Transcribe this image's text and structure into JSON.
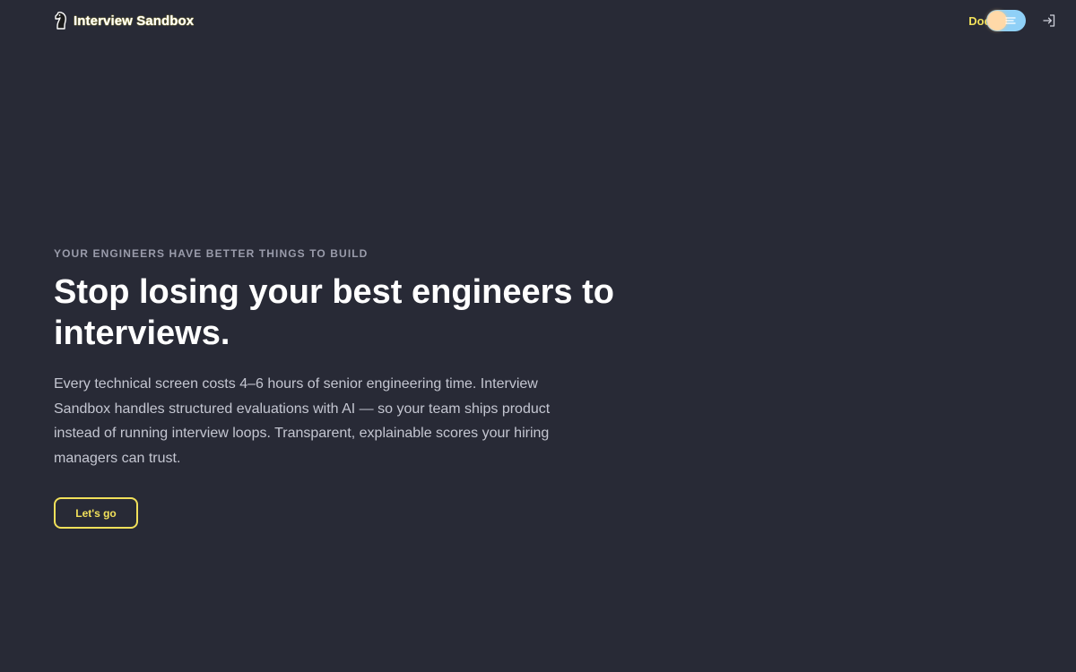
{
  "header": {
    "brand_name": "Interview Sandbox",
    "logo_icon": "chess-knight-icon",
    "docs_label": "Docs",
    "theme_toggle_icon": "sun-icon",
    "signin_icon": "sign-in-icon"
  },
  "hero": {
    "eyebrow": "YOUR ENGINEERS HAVE BETTER THINGS TO BUILD",
    "headline": "Stop losing your best engineers to interviews.",
    "subtext": "Every technical screen costs 4–6 hours of senior engineering time. Interview Sandbox handles structured evaluations with AI — so your team ships product instead of running interview loops. Transparent, explainable scores your hiring managers can trust.",
    "cta_label": "Let's go"
  },
  "colors": {
    "background": "#282a36",
    "accent": "#f1e05a",
    "heading": "#ffffff",
    "body_text": "#c4c6d1",
    "muted_text": "#9a9cab",
    "toggle_track": "#8fd0f7",
    "toggle_knob": "#ffd9a8"
  }
}
